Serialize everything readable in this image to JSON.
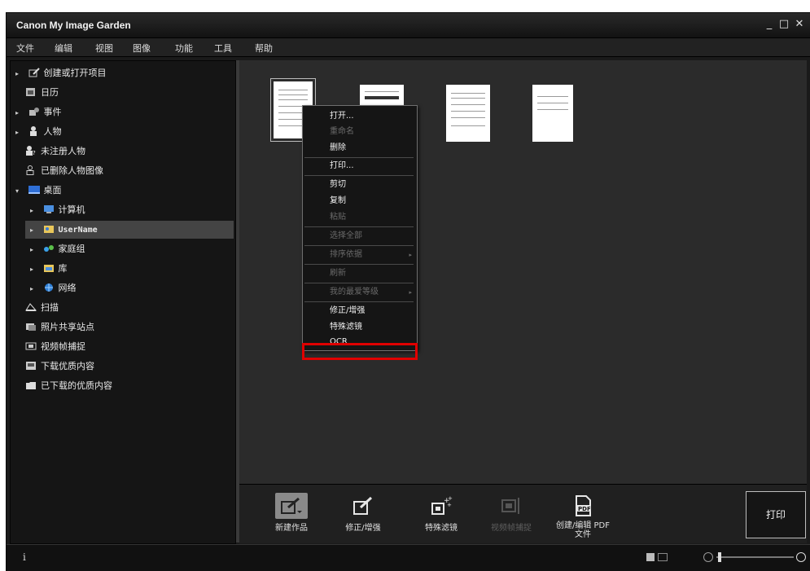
{
  "window": {
    "title": "Canon My Image Garden",
    "controls": [
      "_",
      "□",
      "✕"
    ]
  },
  "menu": [
    "文件",
    "编辑",
    "视图",
    "图像",
    "功能",
    "工具",
    "帮助"
  ],
  "sidebar": {
    "items": [
      {
        "label": "创建或打开项目",
        "icon": "edit-doc-icon",
        "arrow": "▸"
      },
      {
        "label": "日历",
        "icon": "calendar-icon",
        "arrow": ""
      },
      {
        "label": "事件",
        "icon": "event-icon",
        "arrow": "▸"
      },
      {
        "label": "人物",
        "icon": "person-icon",
        "arrow": "▸"
      },
      {
        "label": "未注册人物",
        "icon": "person-unknown-icon",
        "arrow": ""
      },
      {
        "label": "已删除人物图像",
        "icon": "person-outline-icon",
        "arrow": ""
      },
      {
        "label": "桌面",
        "icon": "desktop-icon",
        "arrow": "▾"
      },
      {
        "label": "计算机",
        "icon": "computer-icon",
        "arrow": "▸"
      },
      {
        "label": "UserName",
        "icon": "user-folder-icon",
        "arrow": "▸"
      },
      {
        "label": "家庭组",
        "icon": "homegroup-icon",
        "arrow": "▸"
      },
      {
        "label": "库",
        "icon": "library-icon",
        "arrow": "▸"
      },
      {
        "label": "网络",
        "icon": "network-icon",
        "arrow": "▸"
      },
      {
        "label": "扫描",
        "icon": "scan-icon",
        "arrow": ""
      },
      {
        "label": "照片共享站点",
        "icon": "photo-share-icon",
        "arrow": ""
      },
      {
        "label": "视频帧捕捉",
        "icon": "video-capture-icon",
        "arrow": ""
      },
      {
        "label": "下载优质内容",
        "icon": "download-content-icon",
        "arrow": ""
      },
      {
        "label": "已下载的优质内容",
        "icon": "folder-icon",
        "arrow": ""
      }
    ],
    "selected": "UserName"
  },
  "context_menu": {
    "items": [
      {
        "label": "打开...",
        "enabled": true
      },
      {
        "label": "重命名",
        "enabled": false
      },
      {
        "label": "删除",
        "enabled": true
      },
      {
        "label": "打印...",
        "enabled": true
      },
      {
        "label": "剪切",
        "enabled": true
      },
      {
        "label": "复制",
        "enabled": true
      },
      {
        "label": "粘贴",
        "enabled": false
      },
      {
        "label": "选择全部",
        "enabled": false
      },
      {
        "label": "排序依据",
        "enabled": false,
        "submenu": "▸"
      },
      {
        "label": "刷新",
        "enabled": false
      },
      {
        "label": "我的最爱等级",
        "enabled": false,
        "submenu": "▸"
      },
      {
        "label": "修正/增强",
        "enabled": true
      },
      {
        "label": "特殊滤镜",
        "enabled": true
      },
      {
        "label": "OCR",
        "enabled": true,
        "highlighted": true
      }
    ]
  },
  "toolbar": {
    "tools": [
      {
        "label": "新建作品",
        "icon": "new-work-icon",
        "enabled": true,
        "active": true
      },
      {
        "label": "修正/增强",
        "icon": "correct-enhance-icon",
        "enabled": true
      },
      {
        "label": "特殊滤镜",
        "icon": "special-filter-icon",
        "enabled": true
      },
      {
        "label": "视频帧捕捉",
        "icon": "video-frame-icon",
        "enabled": false
      },
      {
        "label": "创建/编辑 PDF 文件",
        "icon": "pdf-icon",
        "enabled": true
      }
    ],
    "print_label": "打印",
    "pdf_icon_text": "PDF"
  },
  "status": {
    "info_label": "i"
  },
  "colors": {
    "highlight": "#e00000",
    "background": "#1a1a1a"
  }
}
